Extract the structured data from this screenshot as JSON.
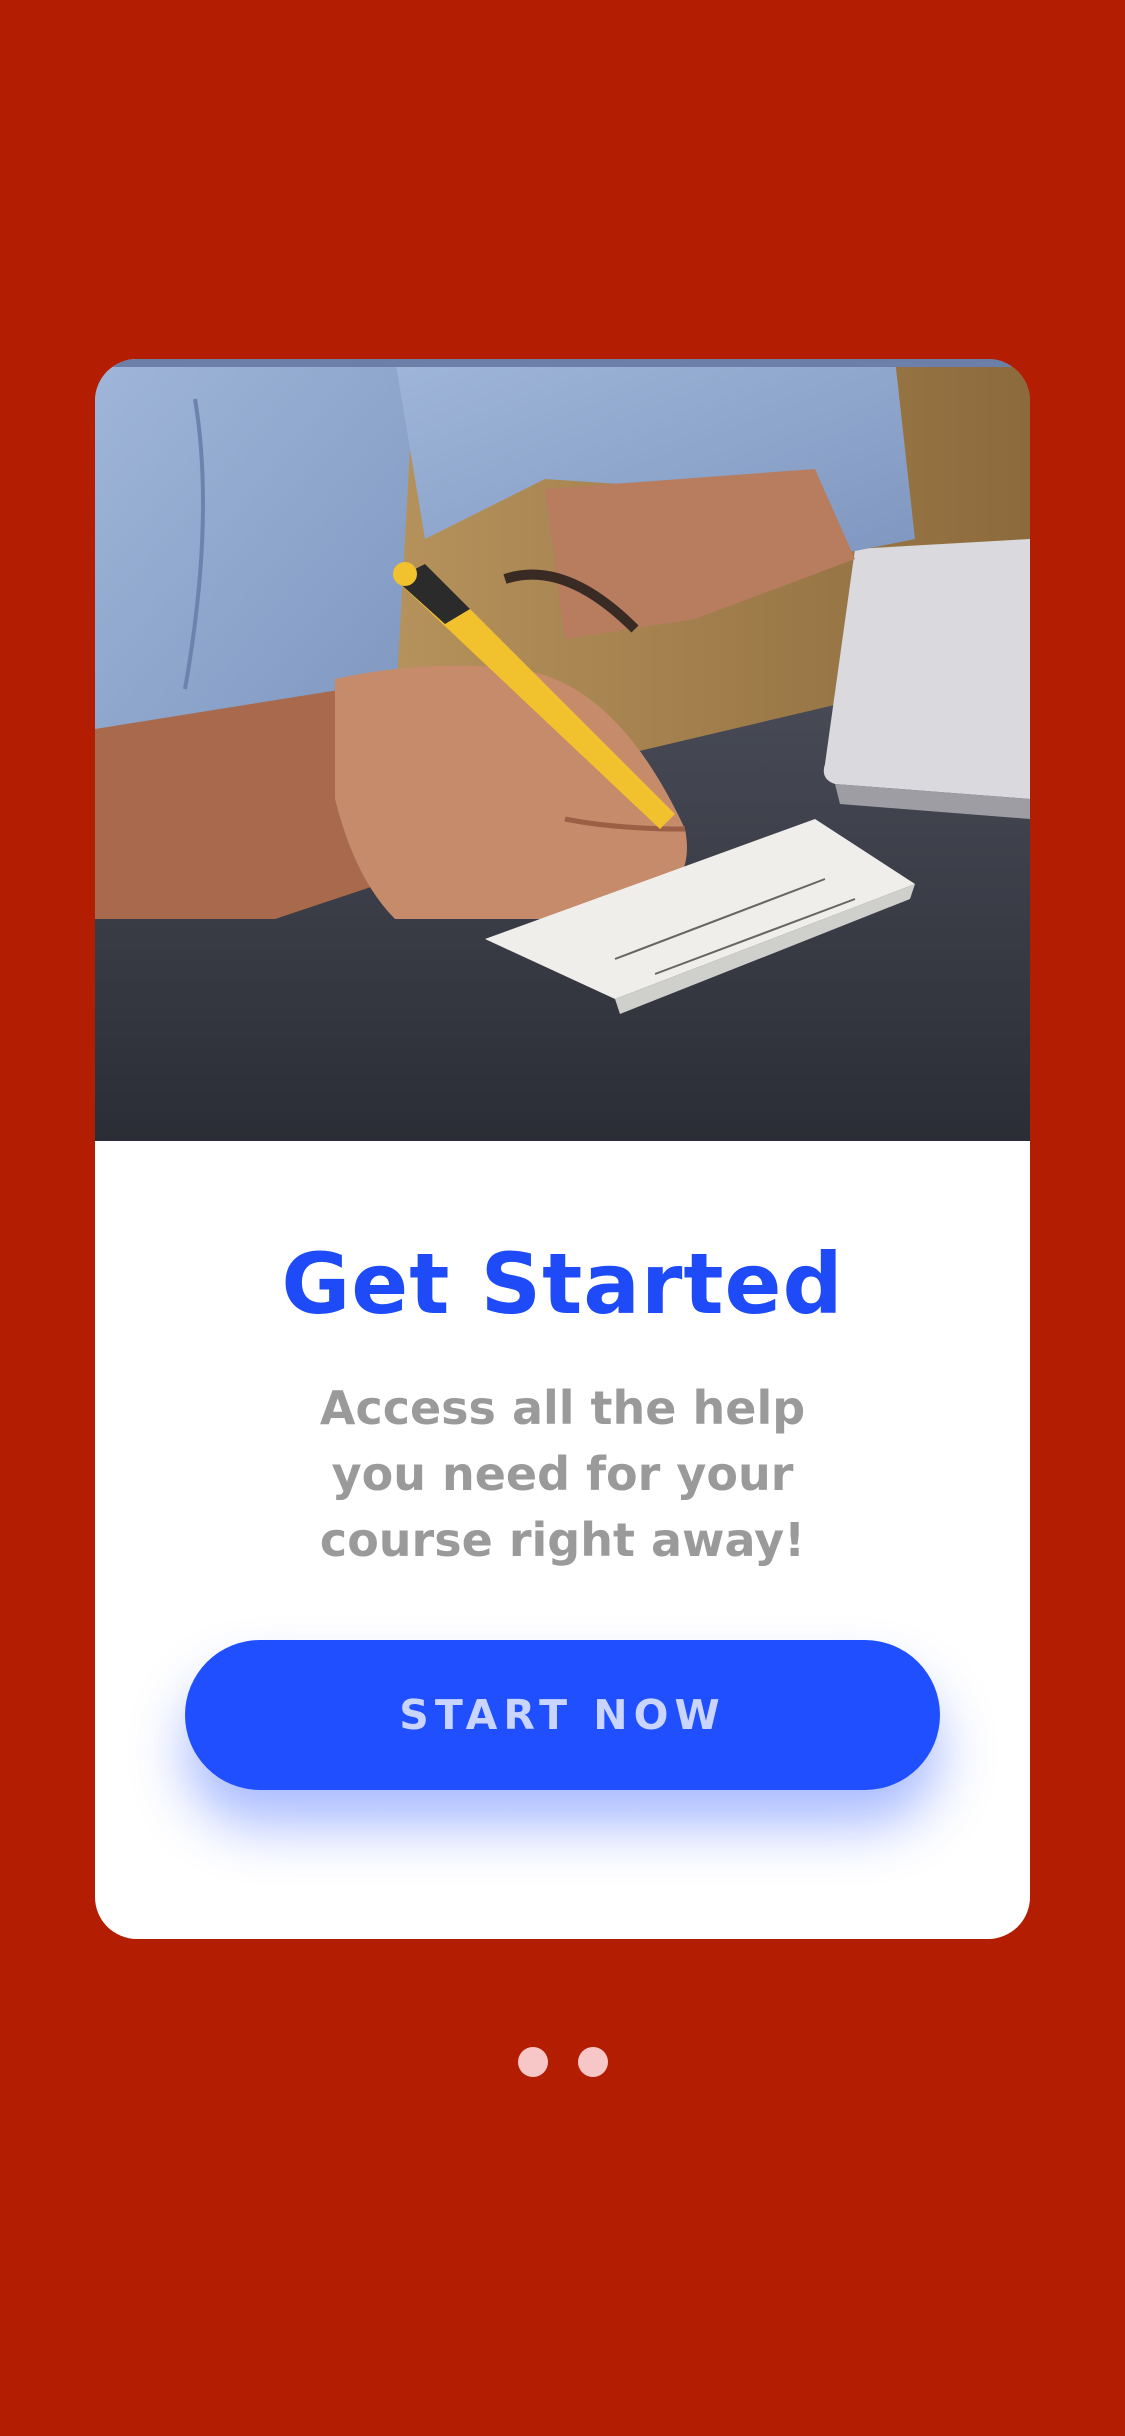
{
  "colors": {
    "background": "#B31E02",
    "card": "#FFFFFF",
    "accent": "#1E4BF7",
    "subtitle": "#9A9A9A",
    "button_text": "#C9D4FF",
    "dot": "#F7C7C7"
  },
  "onboarding": {
    "title": "Get Started",
    "subtitle": "Access all the help you need for your course right away!",
    "cta_label": "START NOW",
    "pager": {
      "page_count": 2,
      "current_page": 1
    }
  },
  "hero": {
    "icon": "photo-person-writing-notes"
  }
}
